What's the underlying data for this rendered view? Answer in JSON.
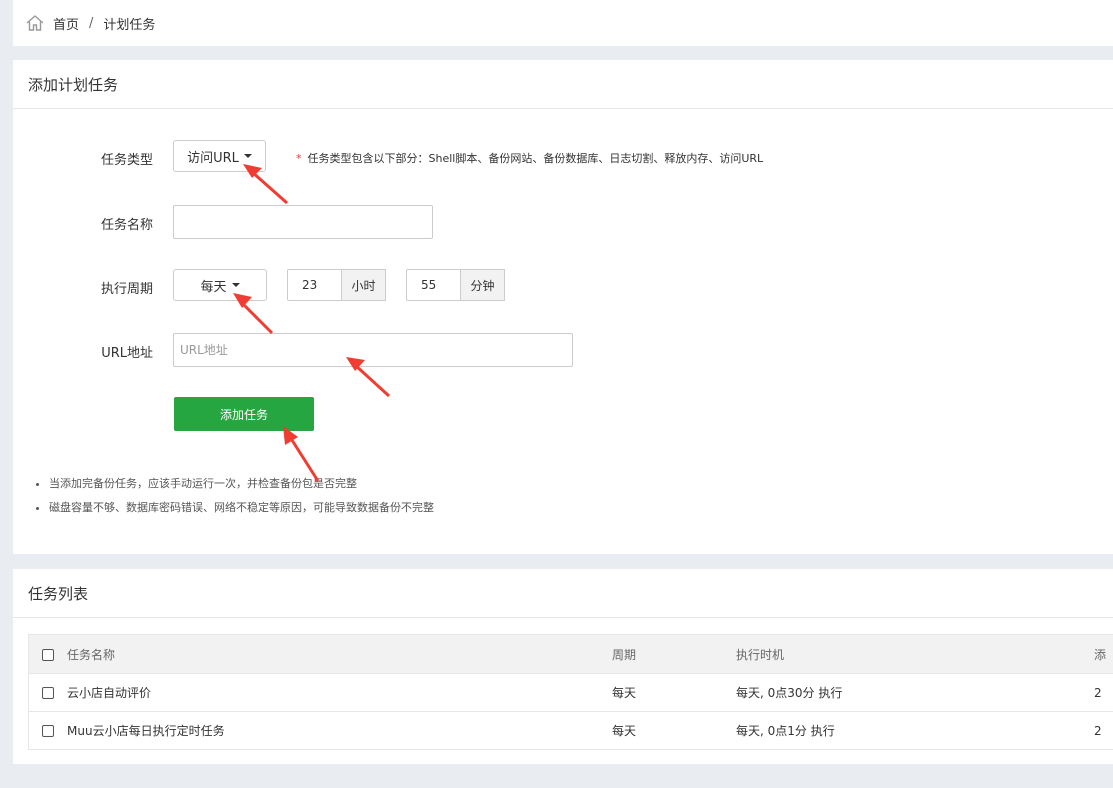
{
  "breadcrumb": {
    "home": "首页",
    "separator": "/",
    "current": "计划任务"
  },
  "form": {
    "title": "添加计划任务",
    "task_type": {
      "label": "任务类型",
      "selected": "访问URL"
    },
    "hint": {
      "star": "*",
      "text": "任务类型包含以下部分：Shell脚本、备份网站、备份数据库、日志切割、释放内存、访问URL"
    },
    "task_name": {
      "label": "任务名称",
      "value": "",
      "placeholder": ""
    },
    "cycle": {
      "label": "执行周期",
      "selected": "每天",
      "hour_value": "23",
      "hour_unit": "小时",
      "minute_value": "55",
      "minute_unit": "分钟"
    },
    "url": {
      "label": "URL地址",
      "value": "",
      "placeholder": "URL地址"
    },
    "submit_label": "添加任务",
    "notes": [
      "当添加完备份任务，应该手动运行一次，并检查备份包是否完整",
      "磁盘容量不够、数据库密码错误、网络不稳定等原因，可能导致数据备份不完整"
    ]
  },
  "list": {
    "title": "任务列表",
    "columns": [
      "任务名称",
      "周期",
      "执行时机",
      "添"
    ],
    "rows": [
      {
        "name": "云小店自动评价",
        "cycle": "每天",
        "time": "每天, 0点30分 执行",
        "extra": "2"
      },
      {
        "name": "Muu云小店每日执行定时任务",
        "cycle": "每天",
        "time": "每天, 0点1分 执行",
        "extra": "2"
      }
    ]
  },
  "colors": {
    "accent_green": "#26a640",
    "annotation_red": "#f03c32",
    "required_star": "#e53935"
  },
  "icons": {
    "home": "home-icon",
    "caret": "caret-down-icon",
    "arrow": "red-arrow-annotation"
  }
}
